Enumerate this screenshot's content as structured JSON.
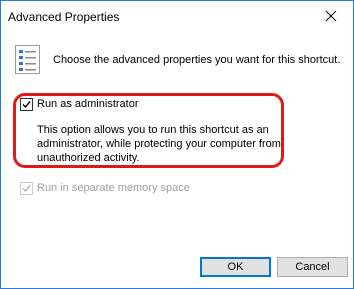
{
  "window": {
    "title": "Advanced Properties"
  },
  "header": {
    "icon": "properties-list-icon",
    "text": "Choose the advanced properties you want for this shortcut."
  },
  "options": {
    "run_as_admin": {
      "label": "Run as administrator",
      "checked": true,
      "enabled": true,
      "description_lines": [
        "This option allows you to run this shortcut as an",
        "administrator, while protecting your computer from",
        "unauthorized activity."
      ]
    },
    "separate_memory": {
      "label": "Run in separate memory space",
      "checked": true,
      "enabled": false
    }
  },
  "buttons": {
    "ok_label": "OK",
    "cancel_label": "Cancel"
  },
  "colors": {
    "window_border": "#2b79d8",
    "highlight": "#e01a1a",
    "default_button_border": "#0078d7",
    "disabled_text": "#a0a0a0"
  }
}
